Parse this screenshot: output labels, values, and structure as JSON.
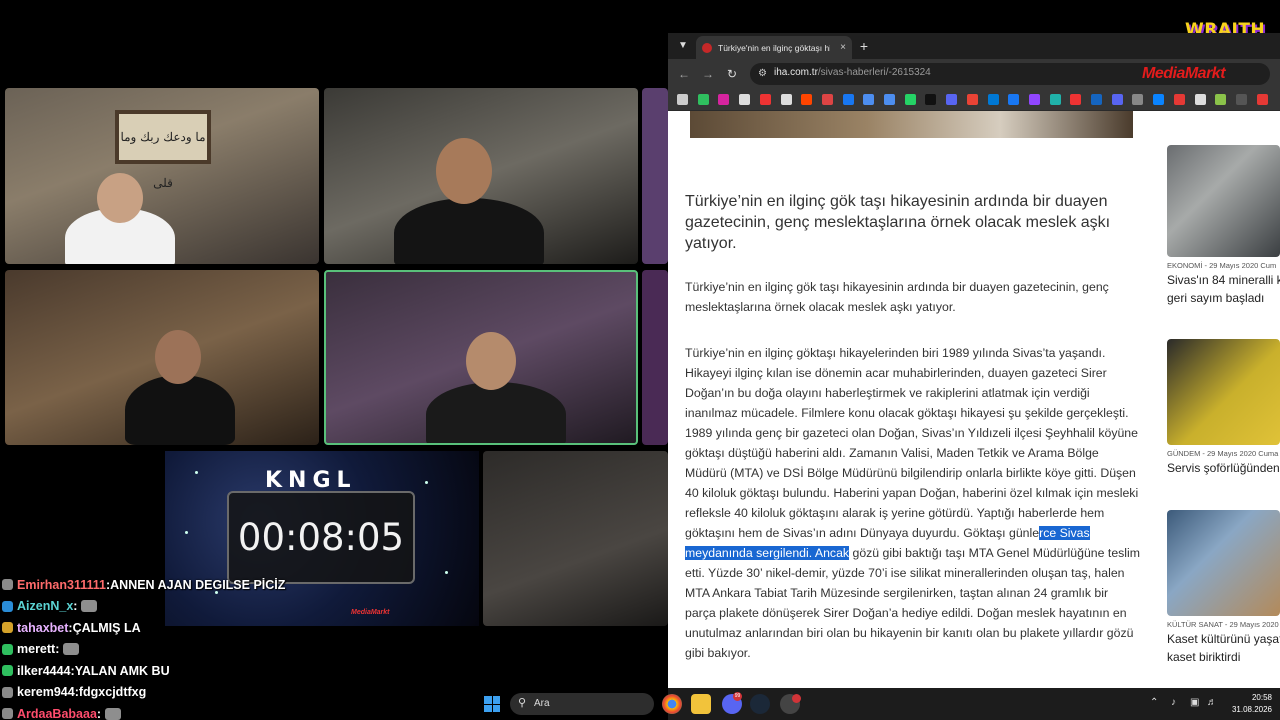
{
  "stream": {
    "brand_logo": "WRAITH",
    "timer_logo": "KNGL",
    "timer": "00:08:05",
    "timer_brand": "MediaMarkt",
    "cam1_art_text": "ما ودعك ربك وما قلى"
  },
  "chat": [
    {
      "user": "Emirhan311111",
      "user_color": "#ff6b6b",
      "badge_color": "#8a8a8a",
      "message": "ANNEN AJAN DEGILSE PİCİZ",
      "emote": false
    },
    {
      "user": "AizenN_x",
      "user_color": "#5bd4d4",
      "badge_color": "#2a8cd6",
      "message": "",
      "emote": true
    },
    {
      "user": "tahaxbet",
      "user_color": "#e7b3ff",
      "badge_color": "#d4a22a",
      "message": "ÇALMIŞ LA",
      "emote": false
    },
    {
      "user": "merett",
      "user_color": "#ffffff",
      "badge_color": "#2fbf5f",
      "message": "",
      "emote": true
    },
    {
      "user": "ilker4444",
      "user_color": "#ffffff",
      "badge_color": "#2fbf5f",
      "message": "YALAN AMK BU",
      "emote": false
    },
    {
      "user": "kerem944",
      "user_color": "#ffffff",
      "badge_color": "#8a8a8a",
      "message": "fdgxcjdtfxg",
      "emote": false
    },
    {
      "user": "ArdaaBabaaa",
      "user_color": "#ff4d6d",
      "badge_color": "#8a8a8a",
      "message": "",
      "emote": true
    }
  ],
  "browser": {
    "tab_title": "Türkiye'nin en ilginç göktaşı hikayesi",
    "url_host": "iha.com.tr",
    "url_path": "/sivas-haberleri/-2615324",
    "ad_text": "MediaMarkt",
    "new_tab_symbol": "+",
    "tab_close_symbol": "×"
  },
  "article": {
    "lead": "Türkiye’nin en ilginç gök taşı hikayesinin ardında bir duayen gazetecinin, genç meslektaşlarına örnek olacak meslek aşkı yatıyor.",
    "summary": "Türkiye’nin en ilginç gök taşı hikayesinin ardında bir duayen gazetecinin, genç meslektaşlarına örnek olacak meslek aşkı yatıyor.",
    "body_before": "Türkiye’nin en ilginç göktaşı hikayelerinden biri 1989 yılında Sivas’ta yaşandı. Hikayeyi ilginç kılan ise dönemin acar muhabirlerinden, duayen gazeteci Sirer Doğan’ın bu doğa olayını haberleştirmek ve rakiplerini atlatmak için verdiği inanılmaz mücadele. Filmlere konu olacak göktaşı hikayesi şu şekilde gerçekleşti. 1989 yılında genç bir gazeteci olan Doğan, Sivas’ın Yıldızeli ilçesi Şeyhhalil köyüne göktaşı düştüğü haberini aldı. Zamanın Valisi, Maden Tetkik ve Arama Bölge Müdürü (MTA) ve DSİ Bölge Müdürünü bilgilendirip onlarla birlikte köye gitti. Düşen 40 kiloluk göktaşı bulundu. Haberini yapan Doğan, haberini özel kılmak için mesleki refleksle 40 kiloluk göktaşını alarak iş yerine götürdü. Yaptığı haberlerde hem göktaşını hem de Sivas’ın adını Dünyaya duyurdu. Göktaşı günle",
    "body_highlight": "rce Sivas meydanında sergilendi. Ancak",
    "body_after": " gözü gibi baktığı taşı MTA Genel Müdürlüğüne teslim etti. Yüzde 30’ nikel-demir, yüzde 70’i ise silikat minerallerinden oluşan taş, halen MTA Ankara Tabiat Tarih Müzesinde sergilenirken, taştan alınan 24 gramlık bir parça plakete dönüşerek Sirer Doğan’a hediye edildi. Doğan meslek hayatının en unutulmaz anlarından biri olan bu hikayenin bir kanıtı olan bu plakete yıllardır gözü gibi bakıyor."
  },
  "sidebar": [
    {
      "category": "EKONOMİ - 29 Mayıs 2020 Cum",
      "title_1": "Sivas'ın 84 mineralli k",
      "title_2": "geri sayım başladı"
    },
    {
      "category": "GÜNDEM - 29 Mayıs 2020 Cuma",
      "title_1": "Servis şoförlüğünden",
      "title_2": ""
    },
    {
      "category": "KÜLTÜR SANAT - 29 Mayıs 2020",
      "title_1": "Kaset kültürünü yaşat",
      "title_2": "kaset biriktirdi"
    }
  ],
  "taskbar": {
    "search_placeholder": "Ara",
    "time": "20:58",
    "date": "31.08.2026",
    "discord_badge": "99"
  },
  "colors": {
    "highlight": "#1967d2",
    "wraith_yellow": "#f7d21c",
    "mm_red": "#e31c1c"
  }
}
